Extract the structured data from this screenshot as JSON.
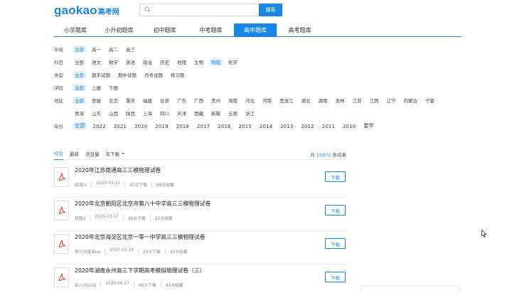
{
  "header": {
    "logo_en": "gaokao",
    "logo_cn": "高考网",
    "search_placeholder": "",
    "search_button": "搜索"
  },
  "nav": {
    "tabs": [
      "小学题库",
      "小升初题库",
      "初中题库",
      "中考题库",
      "高中题库",
      "高考题库"
    ],
    "active_index": 4
  },
  "filters": {
    "grade": {
      "label": "年级",
      "options": [
        "全部",
        "高一",
        "高二",
        "高三"
      ],
      "selected": 0
    },
    "subject": {
      "label": "科目",
      "options": [
        "全部",
        "语文",
        "数学",
        "英语",
        "政治",
        "历史",
        "地理",
        "生物",
        "物理",
        "化学"
      ],
      "selected": 8
    },
    "type": {
      "label": "类型",
      "options": [
        "全部",
        "期末试题",
        "期中试题",
        "月考试题",
        "练习题"
      ],
      "selected": 0
    },
    "term": {
      "label": "学段",
      "options": [
        "全部",
        "上册",
        "下册"
      ],
      "selected": 0
    },
    "region": {
      "label": "地区",
      "row1": [
        "全部",
        "安徽",
        "北京",
        "重庆",
        "福建",
        "甘肃",
        "广东",
        "广西",
        "贵州",
        "海南",
        "河北",
        "河南",
        "黑龙江",
        "湖北",
        "湖南",
        "吉林",
        "江苏",
        "江西",
        "辽宁",
        "内蒙古",
        "宁夏"
      ],
      "row2": [
        "青海",
        "山东",
        "山西",
        "陕西",
        "上海",
        "四川",
        "天津",
        "西藏",
        "新疆",
        "云南",
        "浙江"
      ],
      "selected": 0
    },
    "year": {
      "label": "年份",
      "options": [
        "全部",
        "2022",
        "2021",
        "2020",
        "2019",
        "2018",
        "2017",
        "2016",
        "2015",
        "2014",
        "2013",
        "2012",
        "2011",
        "2010",
        "更早"
      ],
      "selected": 0
    }
  },
  "sort": {
    "options": [
      "综合",
      "最新",
      "浏览量",
      "年下载"
    ],
    "active_index": 0,
    "total_prefix": "共",
    "total_count": "15872",
    "total_suffix": "条结果"
  },
  "results": [
    {
      "title": "2020年江苏南通高三三模物理试卷",
      "author": "闻涛川",
      "date": "2020-02-11",
      "downloads": "47次下载",
      "favorites": "66次收藏",
      "button": "下载"
    },
    {
      "title": "2020年北京朝阳区北京市第八十中学高三三模物理试卷",
      "author": "获茵d",
      "date": "2020-03-17",
      "downloads": "45次下载",
      "favorites": "22次收藏",
      "button": "下载"
    },
    {
      "title": "2020年北京海淀区北京一零一中学高三三模物理试卷",
      "author": "周只天蓬商ue",
      "date": "2020-03-19",
      "downloads": "20次下载",
      "favorites": "43次收藏",
      "button": "下载"
    },
    {
      "title": "2020年湖南永州高三下学期高考模拟物理试卷（三）",
      "author": "朵儿001zQ",
      "date": "2020-06-27",
      "downloads": "46次下载",
      "favorites": "43次收藏",
      "button": "下载"
    }
  ],
  "colors": {
    "accent": "#1a87e8",
    "pdf_red": "#e0442e"
  }
}
